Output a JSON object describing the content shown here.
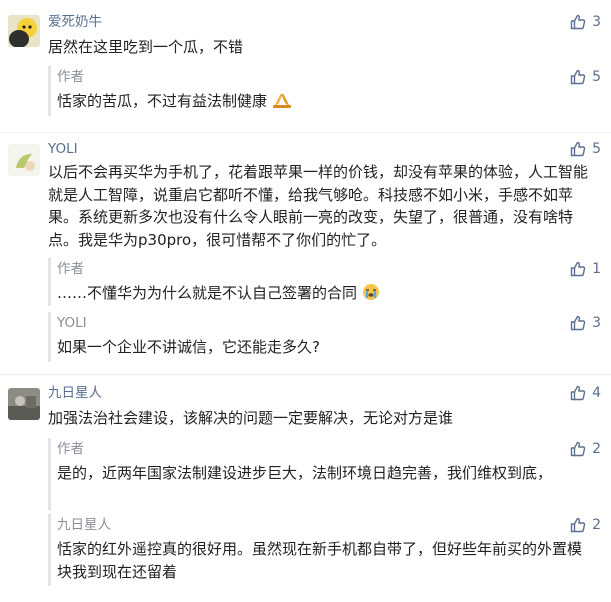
{
  "comments": [
    {
      "name": "爱死奶牛",
      "likes": "3",
      "text": "居然在这里吃到一个瓜，不错",
      "reply": {
        "name": "作者",
        "likes": "5",
        "text": "恬家的苦瓜，不过有益法制健康"
      }
    },
    {
      "name": "YOLI",
      "likes": "5",
      "text": "以后不会再买华为手机了，花着跟苹果一样的价钱，却没有苹果的体验，人工智能就是人工智障，说重启它都听不懂，给我气够呛。科技感不如小米，手感不如苹果。系统更新多次也没有什么令人眼前一亮的改变，失望了，很普通，没有啥特点。我是华为p30pro，很可惜帮不了你们的忙了。",
      "replies": [
        {
          "name": "作者",
          "likes": "1",
          "text": "……不懂华为为什么就是不认自己签署的合同"
        },
        {
          "name": "YOLI",
          "likes": "3",
          "text": "如果一个企业不讲诚信，它还能走多久?"
        }
      ]
    },
    {
      "name": "九日星人",
      "likes": "4",
      "text": "加强法治社会建设，该解决的问题一定要解决，无论对方是谁",
      "replies": [
        {
          "name": "作者",
          "likes": "2",
          "text": "是的，近两年国家法制建设进步巨大，法制环境日趋完善，我们维权到底，"
        },
        {
          "name": "九日星人",
          "likes": "2",
          "text": "恬家的红外遥控真的很好用。虽然现在新手机都自带了，但好些年前买的外置模块我到现在还留着"
        }
      ]
    }
  ],
  "icons": {
    "like": "thumbs-up-icon",
    "pray": "folded-hands-emoji",
    "cry": "crying-face-emoji"
  },
  "colors": {
    "name": "#5a6f8f",
    "reply_name": "#8a8f98",
    "reply_bar": "#e2e4e8"
  }
}
